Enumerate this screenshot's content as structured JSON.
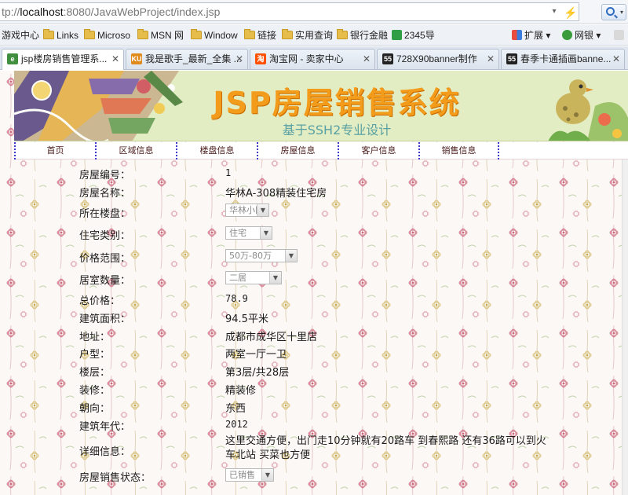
{
  "browser": {
    "url": {
      "prefix": "tp://",
      "host": "localhost",
      "rest": ":8080/JavaWebProject/index.jsp"
    },
    "favorites": [
      {
        "label": "游戏中心",
        "icon": "none"
      },
      {
        "label": "Links",
        "icon": "folder-icon"
      },
      {
        "label": "Microso",
        "icon": "folder-icon"
      },
      {
        "label": "MSN 网",
        "icon": "folder-icon"
      },
      {
        "label": "Window",
        "icon": "folder-icon"
      },
      {
        "label": "链接",
        "icon": "folder-icon"
      },
      {
        "label": "实用查询",
        "icon": "folder-icon"
      },
      {
        "label": "银行金融",
        "icon": "folder-icon"
      },
      {
        "label": "2345导",
        "icon": "2345-icon"
      }
    ],
    "extras": {
      "extensions_label": "扩展",
      "bank_label": "网银"
    },
    "tabs": [
      {
        "label": "jsp楼房销售管理系...",
        "icon": "e",
        "icon_color": "#3f8f3f",
        "active": true
      },
      {
        "label": "我是歌手_最新_全集 ...",
        "icon": "KU",
        "icon_color": "#e08a1c",
        "active": false
      },
      {
        "label": "淘宝网 - 卖家中心",
        "icon": "淘",
        "icon_color": "#ff5000",
        "active": false
      },
      {
        "label": "728X90banner制作",
        "icon": "55",
        "icon_color": "#222222",
        "active": false
      },
      {
        "label": "春季卡通插画banne...",
        "icon": "55",
        "icon_color": "#222222",
        "active": false
      }
    ]
  },
  "page": {
    "banner": {
      "title": "JSP房屋销售系统",
      "subtitle": "基于SSH2专业设计"
    },
    "nav": [
      "首页",
      "区域信息",
      "楼盘信息",
      "房屋信息",
      "客户信息",
      "销售信息"
    ],
    "fields": [
      {
        "label": "房屋编号：",
        "value": "1",
        "kind": "text"
      },
      {
        "label": "房屋名称：",
        "value": "华林A-308精装住宅房",
        "kind": "text"
      },
      {
        "label": "所在楼盘：",
        "value": "华林小区",
        "kind": "select"
      },
      {
        "label": "住宅类别：",
        "value": "住宅",
        "kind": "select"
      },
      {
        "label": "价格范围：",
        "value": "50万-80万",
        "kind": "select"
      },
      {
        "label": "居室数量：",
        "value": "二居",
        "kind": "select"
      },
      {
        "label": "总价格：",
        "value": "78.9",
        "kind": "text"
      },
      {
        "label": "建筑面积：",
        "value": "94.5平米",
        "kind": "text"
      },
      {
        "label": "地址：",
        "value": "成都市成华区十里店",
        "kind": "text"
      },
      {
        "label": "户型：",
        "value": "两室一厅一卫",
        "kind": "text"
      },
      {
        "label": "楼层：",
        "value": "第3层/共28层",
        "kind": "text"
      },
      {
        "label": "装修：",
        "value": "精装修",
        "kind": "text"
      },
      {
        "label": "朝向：",
        "value": "东西",
        "kind": "text"
      },
      {
        "label": "建筑年代：",
        "value": "2012",
        "kind": "text"
      },
      {
        "label": "详细信息：",
        "value": "这里交通方便，出门走10分钟就有20路车 到春熙路 还有36路可以到火车北站 买菜也方便",
        "kind": "text"
      },
      {
        "label": "房屋销售状态：",
        "value": "已销售",
        "kind": "select"
      }
    ]
  }
}
